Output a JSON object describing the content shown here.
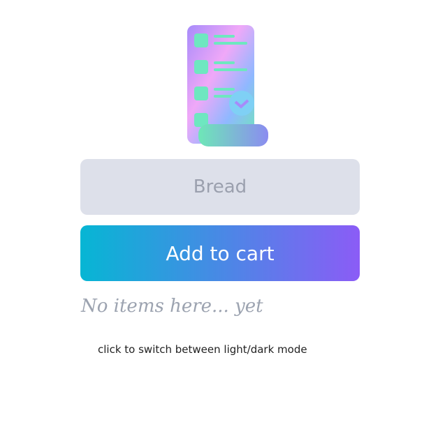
{
  "illustration": "checklist-scroll-icon",
  "input": {
    "value": "",
    "placeholder": "Bread"
  },
  "add_button": "Add to cart",
  "empty_message": "No items here... yet",
  "mode_toggle": "click to switch between light/dark mode"
}
